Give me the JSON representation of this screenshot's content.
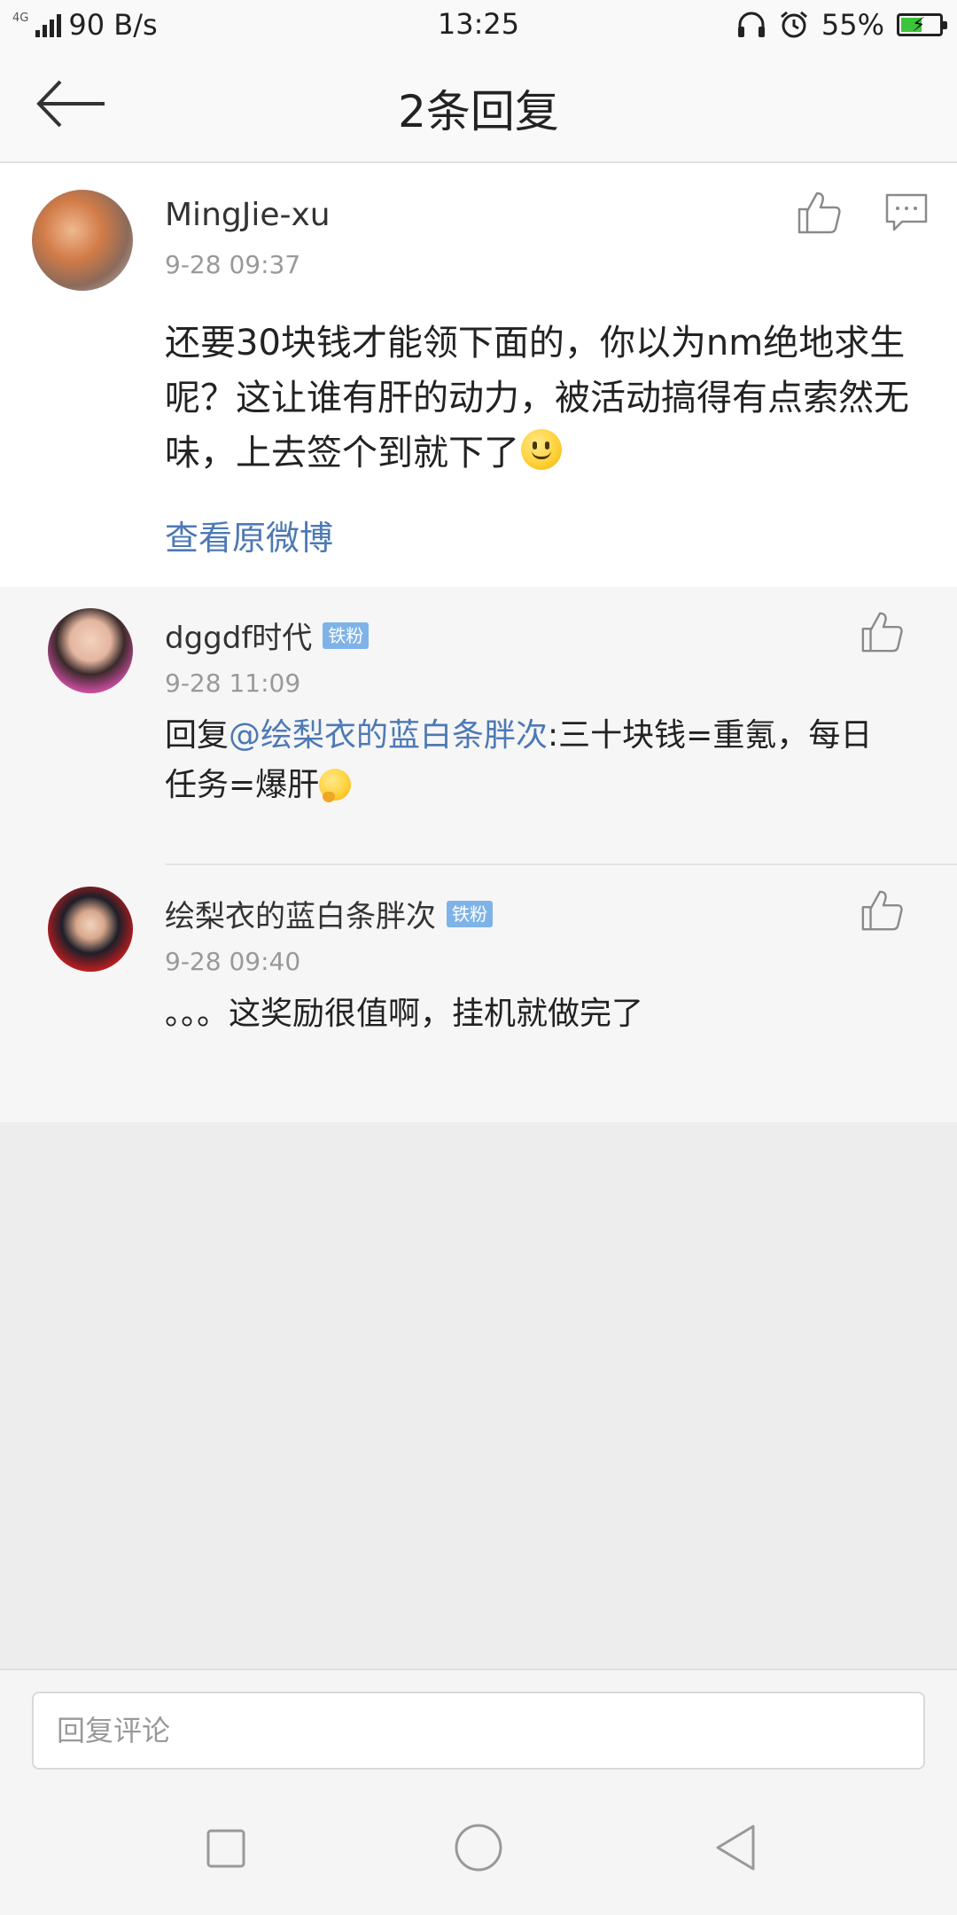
{
  "status_bar": {
    "network": "4G",
    "speed": "90 B/s",
    "time": "13:25",
    "battery": "55%",
    "battery_level": 0.55
  },
  "header": {
    "title": "2条回复"
  },
  "main_comment": {
    "author": "MingJie-xu",
    "time": "9-28 09:37",
    "text": "还要30块钱才能领下面的，你以为nm绝地求生呢？这让谁有肝的动力，被活动搞得有点索然无味，上去签个到就下了",
    "view_original": "查看原微博"
  },
  "replies": [
    {
      "author": "dggdf时代",
      "badge": "铁粉",
      "time": "9-28 11:09",
      "prefix": "回复",
      "mention": "@绘梨衣的蓝白条胖次",
      "text": ":三十块钱=重氪，每日任务=爆肝"
    },
    {
      "author": "绘梨衣的蓝白条胖次",
      "badge": "铁粉",
      "time": "9-28 09:40",
      "text": "。。。这奖励很值啊，挂机就做完了"
    }
  ],
  "reply_input": {
    "placeholder": "回复评论"
  },
  "colors": {
    "link": "#4d79b4",
    "badge": "#7fb3e8"
  }
}
